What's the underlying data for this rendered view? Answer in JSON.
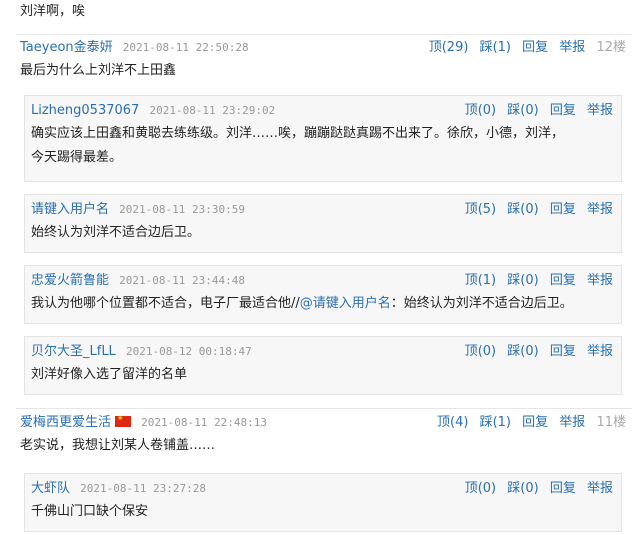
{
  "previous_comment_tail": "刘洋啊，唉",
  "actions": {
    "up": "顶",
    "down": "踩",
    "reply": "回复",
    "report": "举报"
  },
  "comments": [
    {
      "user": "Taeyeon金泰妍",
      "time": "2021-08-11 22:50:28",
      "up": "(29)",
      "down": "(1)",
      "floor": "12楼",
      "text": "最后为什么上刘洋不上田鑫",
      "replies": [
        {
          "user": "Lizheng0537067",
          "time": "2021-08-11 23:29:02",
          "up": "(0)",
          "down": "(0)",
          "text_line1": "确实应该上田鑫和黄聪去练练级。刘洋……唉，蹦蹦跶跶真踢不出来了。徐欣，小德，刘洋，",
          "text_line2": "今天踢得最差。"
        },
        {
          "user": "请键入用户名",
          "time": "2021-08-11 23:30:59",
          "up": "(5)",
          "down": "(0)",
          "text": "始终认为刘洋不适合边后卫。"
        },
        {
          "user": "忠爱火箭鲁能",
          "time": "2021-08-11 23:44:48",
          "up": "(1)",
          "down": "(0)",
          "text_before": "我认为他哪个位置都不适合，电子厂最适合他//",
          "mention": "@请键入用户名",
          "text_after": "：始终认为刘洋不适合边后卫。"
        },
        {
          "user": "贝尔大圣_LfLL",
          "time": "2021-08-12 00:18:47",
          "up": "(0)",
          "down": "(0)",
          "text": "刘洋好像入选了留洋的名单"
        }
      ]
    },
    {
      "user": "爱梅西更爱生活",
      "time": "2021-08-11 22:48:13",
      "up": "(4)",
      "down": "(1)",
      "floor": "11楼",
      "text": "老实说，我想让刘某人卷铺盖……",
      "replies": [
        {
          "user": "大虾队",
          "time": "2021-08-11 23:27:28",
          "up": "(0)",
          "down": "(0)",
          "text": "千佛山门口缺个保安"
        }
      ]
    }
  ]
}
